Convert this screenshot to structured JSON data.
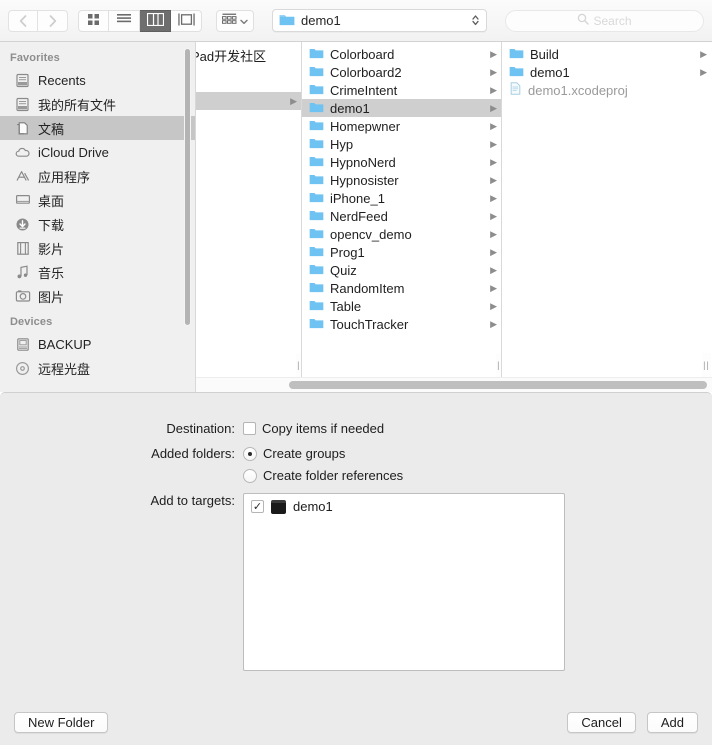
{
  "toolbar": {
    "back_icon": "chevron-left-icon",
    "forward_icon": "chevron-right-icon",
    "view_modes": [
      {
        "name": "icon-view",
        "icon": "grid-icon",
        "active": false
      },
      {
        "name": "list-view",
        "icon": "list-icon",
        "active": false
      },
      {
        "name": "column-view",
        "icon": "columns-icon",
        "active": true
      },
      {
        "name": "gallery-view",
        "icon": "gallery-icon",
        "active": false
      }
    ],
    "arrange_icon": "arrange-grid-icon",
    "arrange_caret": "chevron-down-icon",
    "path_popup": {
      "label": "demo1",
      "folder_icon": "folder-icon",
      "stepper_icon": "stepper-updown-icon"
    },
    "search": {
      "placeholder": "Search",
      "icon": "search-icon",
      "value": ""
    }
  },
  "sidebar": {
    "sections": [
      {
        "header": "Favorites",
        "items": [
          {
            "label": "Recents",
            "icon": "recents-icon",
            "selected": false
          },
          {
            "label": "我的所有文件",
            "icon": "all-files-icon",
            "selected": false
          },
          {
            "label": "文稿",
            "icon": "documents-icon",
            "selected": true
          },
          {
            "label": "iCloud Drive",
            "icon": "icloud-icon",
            "selected": false
          },
          {
            "label": "应用程序",
            "icon": "applications-icon",
            "selected": false
          },
          {
            "label": "桌面",
            "icon": "desktop-icon",
            "selected": false
          },
          {
            "label": "下载",
            "icon": "downloads-icon",
            "selected": false
          },
          {
            "label": "影片",
            "icon": "movies-icon",
            "selected": false
          },
          {
            "label": "音乐",
            "icon": "music-icon",
            "selected": false
          },
          {
            "label": "图片",
            "icon": "pictures-icon",
            "selected": false
          }
        ]
      },
      {
        "header": "Devices",
        "items": [
          {
            "label": "BACKUP",
            "icon": "disk-icon",
            "selected": false
          },
          {
            "label": "远程光盘",
            "icon": "remote-disc-icon",
            "selected": false
          }
        ]
      }
    ]
  },
  "browser": {
    "column1": {
      "top_text": "Pad开发社区",
      "rows": [
        {
          "label": "",
          "selected": true,
          "has_children": true
        }
      ]
    },
    "column2": {
      "rows": [
        {
          "label": "Colorboard",
          "type": "folder",
          "selected": false,
          "has_children": true
        },
        {
          "label": "Colorboard2",
          "type": "folder",
          "selected": false,
          "has_children": true
        },
        {
          "label": "CrimeIntent",
          "type": "folder",
          "selected": false,
          "has_children": true
        },
        {
          "label": "demo1",
          "type": "folder",
          "selected": true,
          "has_children": true
        },
        {
          "label": "Homepwner",
          "type": "folder",
          "selected": false,
          "has_children": true
        },
        {
          "label": "Hyp",
          "type": "folder",
          "selected": false,
          "has_children": true
        },
        {
          "label": "HypnoNerd",
          "type": "folder",
          "selected": false,
          "has_children": true
        },
        {
          "label": "Hypnosister",
          "type": "folder",
          "selected": false,
          "has_children": true
        },
        {
          "label": "iPhone_1",
          "type": "folder",
          "selected": false,
          "has_children": true
        },
        {
          "label": "NerdFeed",
          "type": "folder",
          "selected": false,
          "has_children": true
        },
        {
          "label": "opencv_demo",
          "type": "folder",
          "selected": false,
          "has_children": true
        },
        {
          "label": "Prog1",
          "type": "folder",
          "selected": false,
          "has_children": true
        },
        {
          "label": "Quiz",
          "type": "folder",
          "selected": false,
          "has_children": true
        },
        {
          "label": "RandomItem",
          "type": "folder",
          "selected": false,
          "has_children": true
        },
        {
          "label": "Table",
          "type": "folder",
          "selected": false,
          "has_children": true
        },
        {
          "label": "TouchTracker",
          "type": "folder",
          "selected": false,
          "has_children": true
        }
      ]
    },
    "column3": {
      "rows": [
        {
          "label": "Build",
          "type": "folder",
          "selected": false,
          "has_children": true
        },
        {
          "label": "demo1",
          "type": "folder",
          "selected": false,
          "has_children": true
        },
        {
          "label": "demo1.xcodeproj",
          "type": "file",
          "selected": false,
          "has_children": false
        }
      ]
    },
    "resizer_glyph": "||"
  },
  "options": {
    "destination": {
      "label": "Destination:",
      "checkbox_label": "Copy items if needed",
      "checked": false
    },
    "added_folders": {
      "label": "Added folders:",
      "choices": [
        {
          "label": "Create groups",
          "selected": true
        },
        {
          "label": "Create folder references",
          "selected": false
        }
      ]
    },
    "add_to_targets": {
      "label": "Add to targets:",
      "targets": [
        {
          "label": "demo1",
          "checked": true,
          "checkmark": "✓",
          "icon": "app-target-icon"
        }
      ]
    }
  },
  "footer": {
    "new_folder": "New Folder",
    "cancel": "Cancel",
    "add": "Add"
  },
  "colors": {
    "folder_blue": "#6fc3f2",
    "selection_gray": "#cfcfcf",
    "sidebar_bg": "#f0f0f0",
    "panel_bg": "#ebebeb"
  }
}
